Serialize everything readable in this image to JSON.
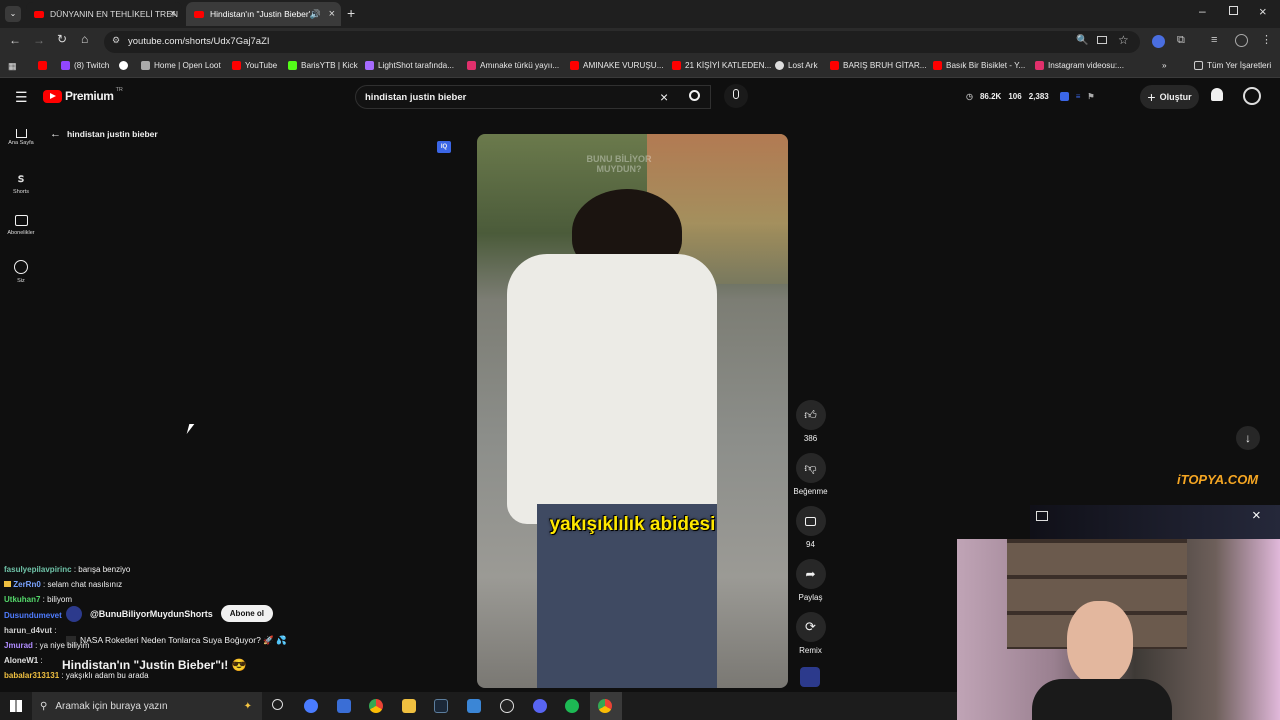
{
  "browser": {
    "tabs": [
      {
        "title": "DÜNYANIN EN TEHLİKELİ TREN"
      },
      {
        "title": "Hindistan'ın \"Justin Bieber\"i"
      }
    ],
    "url": "youtube.com/shorts/Udx7Gaj7aZI",
    "bookmarks": [
      "(8) Twitch",
      "Home | Open Loot",
      "YouTube",
      "BarisYTB | Kick",
      "LightShot tarafında...",
      "Amınake türkü yayıı...",
      "AMINAKE VURUŞU...",
      "21 KİŞİYİ KATLEDEN...",
      "Lost Ark",
      "BARIŞ BRUH GİTAR...",
      "Basık Bir Bisiklet - Y...",
      "Instagram videosu:..."
    ],
    "all_bookmarks": "Tüm Yer İşaretleri"
  },
  "youtube": {
    "logo": "Premium",
    "region": "TR",
    "search_value": "hindistan justin bieber",
    "stats": {
      "views": "86.2K",
      "count1": "106",
      "count2": "2,383"
    },
    "create_label": "Oluştur",
    "back_label": "hindistan justin bieber",
    "sidebar": [
      {
        "label": "Ana Sayfa"
      },
      {
        "label": "Shorts"
      },
      {
        "label": "Abonelikler"
      },
      {
        "label": "Siz"
      }
    ],
    "video": {
      "caption": "yakışıklılık abidesi",
      "watermark": "BUNU BİLİYOR MUYDUN?"
    },
    "actions": {
      "like_count": "386",
      "dislike_label": "Beğenme",
      "comment_count": "94",
      "share_label": "Paylaş",
      "remix_label": "Remix"
    },
    "channel": "@BunuBiliyorMuydunShorts",
    "subscribe_label": "Abone ol",
    "related_title": "NASA Roketleri Neden Tonlarca Suya Boğuyor? 🚀 💦",
    "short_title": "Hindistan'ın \"Justin Bieber\"ı! 😎",
    "site_logo": "iTOPYA.COM"
  },
  "chat": [
    {
      "user": "fasulyepilavpirinc",
      "msg": "barışa benziyo",
      "color": "#6fc3a8"
    },
    {
      "user": "ZerRn0",
      "msg": "selam chat nasılsınız",
      "color": "#7aa3ff"
    },
    {
      "user": "Utkuhan7",
      "msg": "biliyom",
      "color": "#54d86b"
    },
    {
      "user": "Dusundumevet",
      "msg": "",
      "color": "#4f7cff"
    },
    {
      "user": "harun_d4vut",
      "msg": "",
      "color": "#d0d0d0"
    },
    {
      "user": "Jmurad",
      "msg": "ya niye biliyim",
      "color": "#b08cff"
    },
    {
      "user": "AloneW1",
      "msg": "",
      "color": "#e0e0e0"
    },
    {
      "user": "babalar313131",
      "msg": "yakşıklı adam bu arada",
      "color": "#f0c040"
    }
  ],
  "taskbar": {
    "search_placeholder": "Aramak için buraya yazın"
  },
  "colors": {
    "accent": "#ff0000",
    "bg": "#0f0f0f",
    "caption": "#ffe800"
  }
}
